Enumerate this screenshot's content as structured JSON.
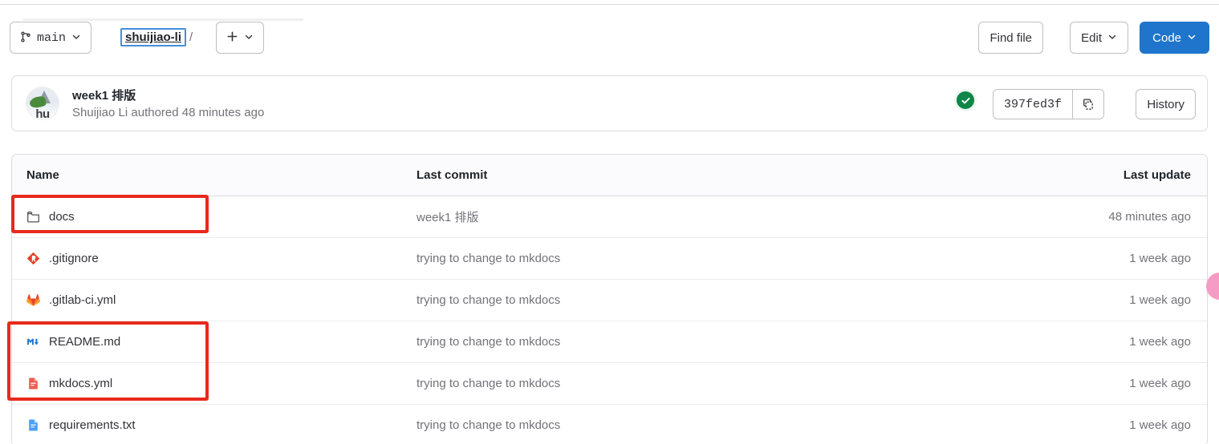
{
  "toolbar": {
    "branch": {
      "label": "main",
      "icon": "git-branch-icon"
    },
    "breadcrumb": {
      "project": "shuijiao-li",
      "separator": "/"
    },
    "add_button": {
      "label": "+"
    },
    "find_file": "Find file",
    "edit": "Edit",
    "code": "Code"
  },
  "commit": {
    "title": "week1 排版",
    "author": "Shuijiao Li",
    "meta": "Shuijiao Li authored 48 minutes ago",
    "authored_text": "authored 48 minutes ago",
    "sha": "397fed3f",
    "history_label": "History",
    "pipeline_status": "passed",
    "avatar_initials": "hu",
    "accent_success": "#108548"
  },
  "table": {
    "columns": {
      "name": "Name",
      "last_commit": "Last commit",
      "last_update": "Last update"
    },
    "rows": [
      {
        "name": "docs",
        "icon": "folder-icon",
        "type": "folder",
        "last_commit": "week1 排版",
        "last_update": "48 minutes ago"
      },
      {
        "name": ".gitignore",
        "icon": "git-file-icon",
        "type": "file",
        "last_commit": "trying to change to mkdocs",
        "last_update": "1 week ago"
      },
      {
        "name": ".gitlab-ci.yml",
        "icon": "gitlab-tanuki-icon",
        "type": "file",
        "last_commit": "trying to change to mkdocs",
        "last_update": "1 week ago"
      },
      {
        "name": "README.md",
        "icon": "markdown-icon",
        "type": "file",
        "last_commit": "trying to change to mkdocs",
        "last_update": "1 week ago"
      },
      {
        "name": "mkdocs.yml",
        "icon": "yaml-file-icon",
        "type": "file",
        "last_commit": "trying to change to mkdocs",
        "last_update": "1 week ago"
      },
      {
        "name": "requirements.txt",
        "icon": "text-file-icon",
        "type": "file",
        "last_commit": "trying to change to mkdocs",
        "last_update": "1 week ago"
      }
    ]
  },
  "annotations": {
    "highlight_color": "#e8291c",
    "boxes": [
      {
        "target": "docs-row"
      },
      {
        "target": "readme-and-mkdocs-rows"
      }
    ]
  },
  "colors": {
    "primary_button": "#1f75cb",
    "focus_ring": "#428fdc",
    "muted_text": "#737278"
  }
}
